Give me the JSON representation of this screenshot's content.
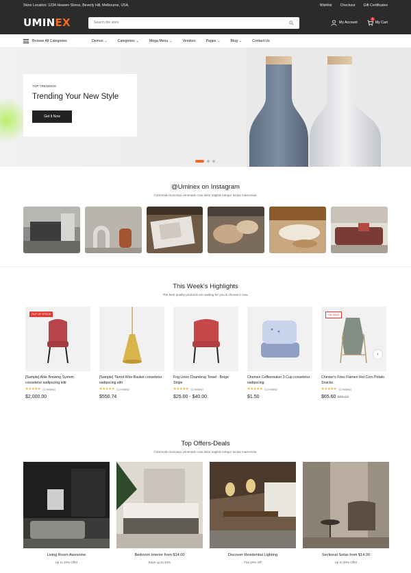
{
  "topbar": {
    "location": "Store Location: 1234 Heaven Stress, Beverly Hill, Melbourne, USA.",
    "links": [
      "Wishlist",
      "Checkout",
      "Gift Certificates"
    ]
  },
  "header": {
    "logo_main": "UMIN",
    "logo_accent": "EX",
    "search_placeholder": "Search the store",
    "account": "My Account",
    "cart": "My Cart",
    "cart_count": "0"
  },
  "nav": {
    "browse": "Browse All Categories",
    "items": [
      "Demos",
      "Categories",
      "Mega Menu",
      "Vendors",
      "Pages",
      "Blog",
      "Contact Us"
    ]
  },
  "hero": {
    "kicker": "TOP TRENDING",
    "title": "Trending Your New Style",
    "button": "Get It Now",
    "slides": 3,
    "active_slide": 1
  },
  "instagram": {
    "title": "@Uminex on Instagram",
    "subtitle": "Commodo sociosqu venenatis cras dolor sagittis integer luctus maecenas."
  },
  "highlights": {
    "title": "This Week's Highlights",
    "subtitle": "The best quality products are waiting for you & choose it now.",
    "products": [
      {
        "badge": "OUT OF STOCK",
        "name": "[Sample] Able Brewing System consetetur sadipscing elitr",
        "rating": "★★★★★",
        "reviews": "(1 review)",
        "price": "$2,000.00",
        "old_price": ""
      },
      {
        "badge": "",
        "name": "[Sample] Tiered Wire Basket consetetur sadipscing elitr",
        "rating": "★★★★★",
        "reviews": "(1 review)",
        "price": "$550.74",
        "old_price": ""
      },
      {
        "badge": "",
        "name": "Fog Linen Chambray Towel - Beige Stripe",
        "rating": "★★★★★",
        "reviews": "(1 review)",
        "price": "$25.00 - $40.00",
        "old_price": ""
      },
      {
        "badge": "",
        "name": "Chemex Coffeemaker 3 Cup consetetur sadipscing",
        "rating": "★★★★★",
        "reviews": "(1 review)",
        "price": "$1.50",
        "old_price": ""
      },
      {
        "badge": "ON SALE",
        "name": "Chester's Fries Flamen Hot Corn Potato Snacks",
        "rating": "★★★★★",
        "reviews": "(1 review)",
        "price": "$65.60",
        "old_price": "$80.00"
      }
    ],
    "next_icon": "›"
  },
  "offers": {
    "title": "Top Offers-Deals",
    "subtitle": "Commodo sociosqu venenatis cras dolor sagittis integer luctus maecenas.",
    "items": [
      {
        "title": "Living Room Awesome",
        "sub": "Up to 10% Offer"
      },
      {
        "title": "Bedroom Interior from $14.00",
        "sub": "Save up to 40%"
      },
      {
        "title": "Discover Residential Lighting",
        "sub": "Flat 10% Off"
      },
      {
        "title": "Sectional Sofas from $14.00",
        "sub": "Up to 20% Offer"
      }
    ]
  },
  "colors": {
    "accent": "#f36b21",
    "dark": "#2b2b2b",
    "sale": "#e53935",
    "star": "#f3a81a"
  }
}
